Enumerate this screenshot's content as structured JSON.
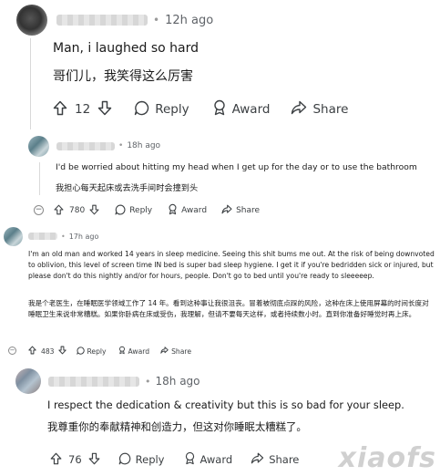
{
  "comments": [
    {
      "time": "12h ago",
      "text_en": "Man, i laughed so hard",
      "text_zh": "哥们儿，我笑得这么厉害",
      "votes": "12",
      "reply": "Reply",
      "award": "Award",
      "share": "Share"
    },
    {
      "time": "18h ago",
      "text_en": "I'd be worried about hitting my head when I get up for the day or to use the bathroom",
      "text_zh": "我担心每天起床或去洗手间时会撞到头",
      "votes": "780",
      "reply": "Reply",
      "award": "Award",
      "share": "Share"
    },
    {
      "time": "17h ago",
      "text_en": "I'm an old man and worked 14 years in sleep medicine. Seeing this shit bums me out. At the risk of being downvoted to oblivion, this level of screen time IN bed is super bad sleep hygiene. I get it if you're bedridden sick or injured, but please don't do this nightly and/or for hours, people. Don't go to bed until you're ready to sleeeeep.",
      "text_zh": "我是个老医生，在睡眠医学领域工作了 14 年。看到这种事让我很沮丧。冒着被彻底点踩的风险，这种在床上使用屏幕的时间长度对睡眠卫生来说非常糟糕。如果你卧病在床或受伤，我理解，但请不要每天这样，或者持续数小时。直到你准备好睡觉时再上床。",
      "votes": "483",
      "reply": "Reply",
      "award": "Award",
      "share": "Share"
    },
    {
      "time": "18h ago",
      "text_en": "I respect the dedication & creativity but this is so bad for your sleep.",
      "text_zh": "我尊重你的奉献精神和创造力，但这对你睡眠太糟糕了。",
      "votes": "76",
      "reply": "Reply",
      "award": "Award",
      "share": "Share"
    }
  ],
  "icons": {
    "upvote": "arrow-up-icon",
    "downvote": "arrow-down-icon",
    "reply": "speech-bubble-icon",
    "award": "award-medal-icon",
    "share": "share-arrow-icon",
    "collapse": "collapse-minus-icon"
  },
  "colors": {
    "text": "#1a1a1a",
    "meta": "#5f6368",
    "thread": "#d9d9d9"
  },
  "watermark": "xiaofs"
}
